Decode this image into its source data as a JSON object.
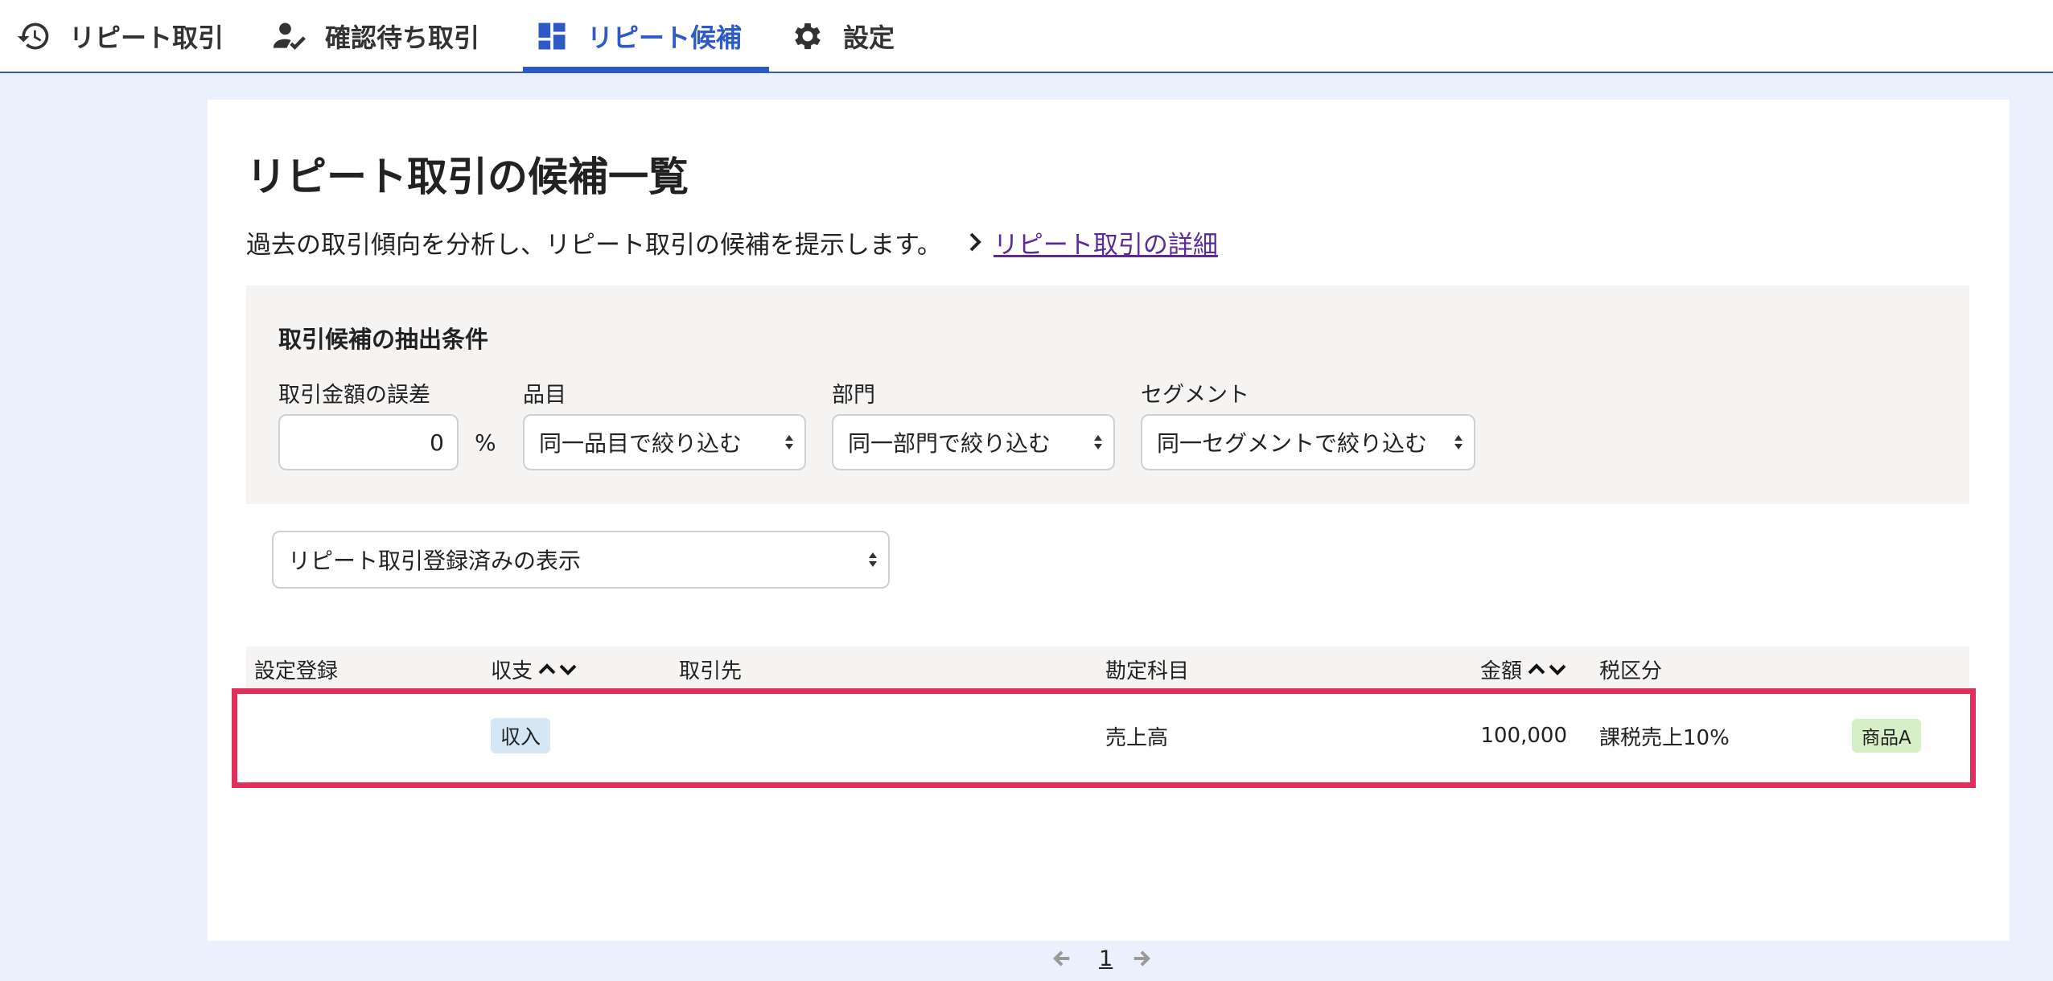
{
  "nav": {
    "tabs": [
      {
        "label": "リピート取引",
        "icon": "history-icon"
      },
      {
        "label": "確認待ち取引",
        "icon": "user-check-icon"
      },
      {
        "label": "リピート候補",
        "icon": "dashboard-icon",
        "active": true
      },
      {
        "label": "設定",
        "icon": "gear-icon"
      }
    ]
  },
  "page": {
    "title": "リピート取引の候補一覧",
    "description": "過去の取引傾向を分析し、リピート取引の候補を提示します。",
    "detail_link": "リピート取引の詳細"
  },
  "filter": {
    "heading": "取引候補の抽出条件",
    "amount_error": {
      "label": "取引金額の誤差",
      "value": "0",
      "unit": "%"
    },
    "item": {
      "label": "品目",
      "selected": "同一品目で絞り込む"
    },
    "department": {
      "label": "部門",
      "selected": "同一部門で絞り込む"
    },
    "segment": {
      "label": "セグメント",
      "selected": "同一セグメントで絞り込む"
    }
  },
  "display_select": {
    "selected": "リピート取引登録済みの表示"
  },
  "table": {
    "headers": {
      "setting": "設定登録",
      "type": "収支",
      "partner": "取引先",
      "account": "勘定科目",
      "amount": "金額",
      "tax": "税区分"
    },
    "rows": [
      {
        "setting": "",
        "type": "収入",
        "partner": "",
        "account": "売上高",
        "amount": "100,000",
        "tax": "課税売上10%",
        "tag": "商品A"
      }
    ]
  },
  "pagination": {
    "current": "1"
  },
  "colors": {
    "accent": "#2e5ac8",
    "highlight": "#e02f5b",
    "link": "#5a2a9a",
    "income_badge": "#d5e6f5",
    "tag_badge": "#d6efc7"
  }
}
